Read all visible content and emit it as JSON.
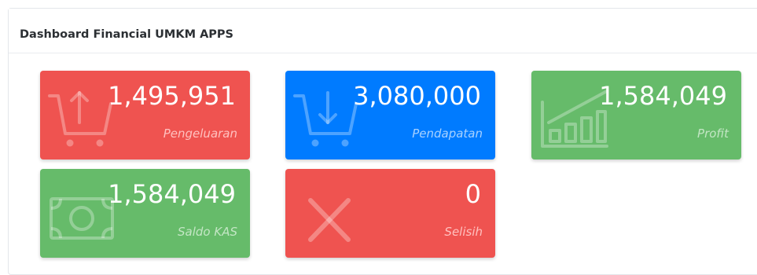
{
  "header": {
    "title": "Dashboard Financial UMKM APPS"
  },
  "tiles": [
    {
      "value": "1,495,951",
      "label": "Pengeluaran",
      "icon": "cart-upload-icon",
      "color": "#ef5350"
    },
    {
      "value": "3,080,000",
      "label": "Pendapatan",
      "icon": "cart-download-icon",
      "color": "#007bff"
    },
    {
      "value": "1,584,049",
      "label": "Profit",
      "icon": "bar-chart-icon",
      "color": "#66bb6a"
    },
    {
      "value": "1,584,049",
      "label": "Saldo KAS",
      "icon": "money-bill-icon",
      "color": "#66bb6a"
    },
    {
      "value": "0",
      "label": "Selisih",
      "icon": "times-icon",
      "color": "#ef5350"
    }
  ]
}
